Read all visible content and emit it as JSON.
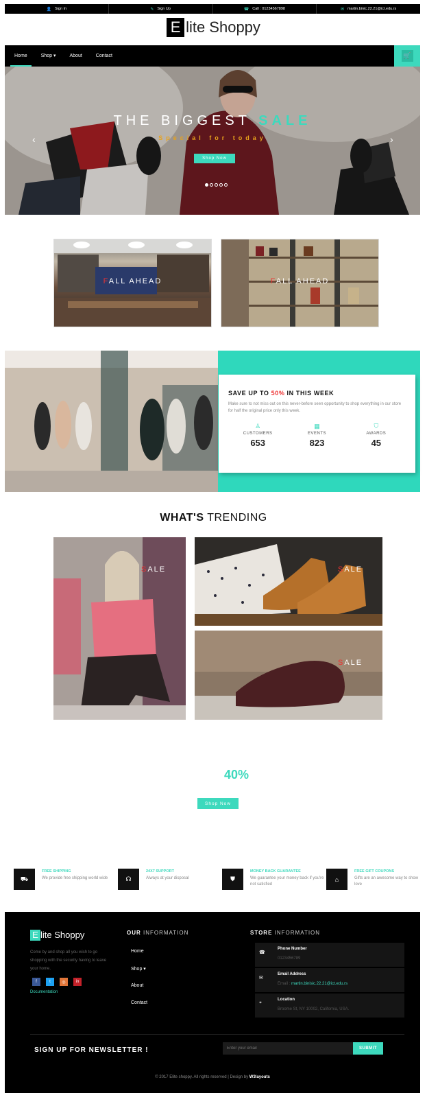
{
  "topbar": {
    "items": [
      {
        "icon": "user-icon",
        "glyph": "👤",
        "label": "Sign In"
      },
      {
        "icon": "pencil-icon",
        "glyph": "✎",
        "label": "Sign Up"
      },
      {
        "icon": "phone-icon",
        "glyph": "☎",
        "label": "Call : 01234567898"
      },
      {
        "icon": "mail-icon",
        "glyph": "✉",
        "label": "martin.binic.22.21@ict.edu.rs"
      }
    ]
  },
  "logo": {
    "letter": "E",
    "rest": "lite Shoppy"
  },
  "nav": {
    "items": [
      "Home",
      "Shop ▾",
      "About",
      "Contact"
    ],
    "cart_glyph": "🛒"
  },
  "hero": {
    "title_a": "THE BIGGEST ",
    "title_b": "SALE",
    "subtitle": "Special for today",
    "button": "Shop Now",
    "prev": "‹",
    "next": "›"
  },
  "promos": [
    {
      "first": "F",
      "rest": "ALL AHEAD"
    },
    {
      "first": "F",
      "rest": "ALL AHEAD"
    }
  ],
  "stats": {
    "title_a": "SAVE UP TO ",
    "title_pct": "50%",
    "title_b": " IN THIS WEEK",
    "desc": "Make sure to not miss out on this never-before seen opportunity to shop everything in our store for half the original price only this week.",
    "items": [
      {
        "icon": "user-icon",
        "glyph": "♙",
        "label": "CUSTOMERS",
        "value": "653"
      },
      {
        "icon": "calendar-icon",
        "glyph": "▦",
        "label": "EVENTS",
        "value": "823"
      },
      {
        "icon": "shield-icon",
        "glyph": "⛉",
        "label": "AWARDS",
        "value": "45"
      }
    ]
  },
  "trending": {
    "title_a": "WHAT'S",
    "title_b": " TRENDING",
    "tiles": [
      {
        "first": "S",
        "rest": "ALE"
      },
      {
        "first": "S",
        "rest": "ALE"
      },
      {
        "first": "S",
        "rest": "ALE"
      }
    ]
  },
  "offer": {
    "percent": "40%",
    "button": "Shop Now"
  },
  "features": [
    {
      "icon": "truck-icon",
      "glyph": "⛟",
      "title": "FREE SHIPPING",
      "desc": "We provide free shipping world wide"
    },
    {
      "icon": "headset-icon",
      "glyph": "☊",
      "title": "24X7 SUPPORT",
      "desc": "Always at your disposal"
    },
    {
      "icon": "bag-icon",
      "glyph": "⛊",
      "title": "MONEY BACK GUARANTEE",
      "desc": "We guarantee your money back if you're not satisfied"
    },
    {
      "icon": "gift-icon",
      "glyph": "⌂",
      "title": "FREE GIFT COUPONS",
      "desc": "Gifts are an awesome way to show love"
    }
  ],
  "footer": {
    "logo_letter": "E",
    "logo_rest": "lite Shoppy",
    "desc": "Come by and shop all you wish to go shopping with the security having to leave your home.",
    "social": [
      {
        "icon": "facebook-icon",
        "glyph": "f",
        "color": "#3b5998"
      },
      {
        "icon": "twitter-icon",
        "glyph": "t",
        "color": "#1da1f2"
      },
      {
        "icon": "instagram-icon",
        "glyph": "◎",
        "color": "#e1763a"
      },
      {
        "icon": "linkedin-icon",
        "glyph": "in",
        "color": "#c4222a"
      }
    ],
    "doc_link": "Documentation",
    "info_heading_a": "OUR",
    "info_heading_b": " INFORMATION",
    "links": [
      "Home",
      "Shop ▾",
      "About",
      "Contact"
    ],
    "store_heading_a": "STORE",
    "store_heading_b": " INFORMATION",
    "store": [
      {
        "icon": "phone-icon",
        "glyph": "☎",
        "label": "Phone Number",
        "value": "0123456789",
        "value_prefix": "",
        "value_link": ""
      },
      {
        "icon": "mail-icon",
        "glyph": "✉",
        "label": "Email Address",
        "value": "",
        "value_prefix": "Email : ",
        "value_link": "martin.binisic.22.21@ict.edu.rs"
      },
      {
        "icon": "location-icon",
        "glyph": "⌖",
        "label": "Location",
        "value": "Broome St, NY 10002, California, USA.",
        "value_prefix": "",
        "value_link": ""
      }
    ],
    "newsletter_label": "SIGN UP FOR NEWSLETTER !",
    "email_placeholder": "Enter your email",
    "submit": "SUBMIT",
    "copyright": "© 2017 Elite shoppy. All rights reserved | Design by ",
    "designer": "W3layouts"
  },
  "colors": {
    "accent": "#3dd9bd",
    "sale_red": "#e33",
    "gold": "#e8a21c"
  }
}
